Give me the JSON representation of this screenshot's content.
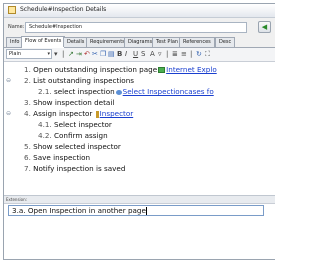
{
  "window": {
    "title": "Schedule#Inspection Details"
  },
  "name_field": {
    "label": "Name:",
    "value": "Schedule#Inspection",
    "button_icon": "green-arrow-icon"
  },
  "tabs": [
    {
      "label": "Info"
    },
    {
      "label": "Flow of Events",
      "active": true
    },
    {
      "label": "Details"
    },
    {
      "label": "Requirements"
    },
    {
      "label": "Diagrams"
    },
    {
      "label": "Test Plan"
    },
    {
      "label": "References"
    },
    {
      "label": "Desc"
    }
  ],
  "toolbar": {
    "combo_value": "Plain"
  },
  "flow_of_events": [
    {
      "num": "1.",
      "text": "Open outstanding inspection page",
      "icon": "doc",
      "link": "Internet Explo"
    },
    {
      "num": "2.",
      "text": "List outstanding inspections",
      "toggle": "⊖"
    },
    {
      "num": "2.1.",
      "text": "select inspection",
      "icon": "usecase",
      "link": "Select Inspectioncases fo"
    },
    {
      "num": "3.",
      "text": "Show inspection detail"
    },
    {
      "num": "4.",
      "text": "Assign inspector",
      "toggle": "⊖",
      "icon": "actor",
      "link": "Inspector"
    },
    {
      "num": "4.1.",
      "text": "Select inspector"
    },
    {
      "num": "4.2.",
      "text": "Confirm assign"
    },
    {
      "num": "5.",
      "text": "Show selected inspector"
    },
    {
      "num": "6.",
      "text": "Save inspection"
    },
    {
      "num": "7.",
      "text": "Notify inspection is saved"
    }
  ],
  "extensions": {
    "header": "Extension:",
    "line_num": "3.a.",
    "line_text": "Open Inspection in another page"
  }
}
